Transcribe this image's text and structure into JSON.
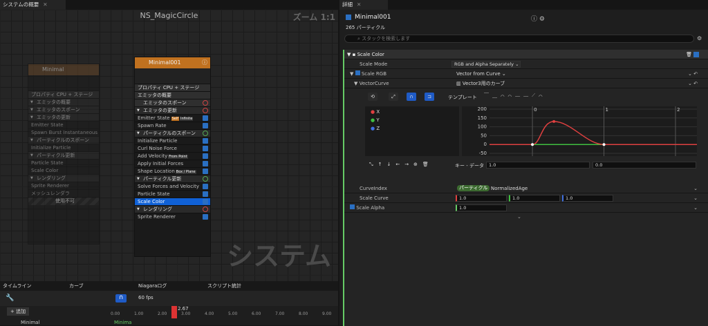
{
  "tabs": {
    "overview": "システムの概要",
    "detail": "詳細"
  },
  "graph": {
    "title": "NS_MagicCircle",
    "zoom": "ズーム 1:1",
    "watermark": "システム"
  },
  "node_left": {
    "title": "Minimal",
    "prop": "プロパティ",
    "cpu": "CPU",
    "stage": "ステージ",
    "rows": [
      "エミッタの概要",
      "エミッタのスポーン",
      "エミッタの更新",
      "Emitter State",
      "Spawn Burst Instantaneous",
      "パーティクルのスポーン",
      "Initialize Particle",
      "パーティクル更新",
      "Particle State",
      "Scale Color",
      "レンダリング",
      "Sprite Renderer",
      "メッシュレンダラ"
    ],
    "self": "Self",
    "infinite": "Infinite",
    "disabled": "使用不可"
  },
  "node_main": {
    "title": "Minimal001",
    "prop": "プロパティ",
    "cpu": "CPU",
    "stage": "ステージ",
    "overview": "エミッタの概要",
    "spawn": "エミッタのスポーン",
    "update": "エミッタの更新",
    "emitter_state": "Emitter State",
    "self": "Self",
    "infinite": "Infinite",
    "spawn_rate": "Spawn Rate",
    "pspawn": "パーティクルのスポーン",
    "init": "Initialize Particle",
    "curl": "Curl Noise Force",
    "addvel": "Add Velocity",
    "frompoint": "From Point",
    "forces": "Apply Initial Forces",
    "shape": "Shape Location",
    "boxplane": "Box / Plane",
    "pupdate": "パーティクル更新",
    "solve": "Solve Forces and Velocity",
    "pstate": "Particle State",
    "scale": "Scale Color",
    "render": "レンダリング",
    "sprite": "Sprite Renderer"
  },
  "bottom": {
    "tabs": [
      "タイムライン",
      "カーブ",
      "Niagaraログ",
      "スクリプト統計"
    ],
    "fps": "60 fps",
    "add": "追加",
    "track": "Minimal",
    "track2": "Minima",
    "playhead": "2.67",
    "ticks": [
      "0.00",
      "1.00",
      "2.00",
      "3.00",
      "4.00",
      "5.00",
      "6.00",
      "7.00",
      "8.00",
      "9.00"
    ]
  },
  "detail": {
    "name": "Minimal001",
    "count": "265 パーティクル",
    "search": "スタックを検索します",
    "section": "Scale Color",
    "scale_mode": "Scale Mode",
    "scale_mode_val": "RGB and Alpha Separately",
    "scale_rgb": "Scale RGB",
    "vfc": "Vector from Curve",
    "vcurve": "VectorCurve",
    "vcurve_val": "Vector3用のカーブ",
    "template": "テンプレート",
    "channels": [
      "X",
      "Y",
      "Z"
    ],
    "keydata": "キー - データ",
    "key1": "1.0",
    "key2": "0.0",
    "curve_index": "CurveIndex",
    "pill": "パーティクル",
    "norm_age": "NormalizedAge",
    "scale_curve": "Scale Curve",
    "sc": [
      "1.0",
      "1.0",
      "1.0"
    ],
    "scale_alpha": "Scale Alpha",
    "alpha": "1.0",
    "y_ticks": [
      "200",
      "150",
      "100",
      "50",
      "0",
      "-50"
    ],
    "x_ticks": [
      "0",
      "1",
      "2"
    ]
  },
  "chart_data": {
    "type": "line",
    "x": [
      0,
      0.3,
      1
    ],
    "series": [
      {
        "name": "X",
        "values": [
          0,
          130,
          0
        ]
      },
      {
        "name": "Y",
        "values": [
          0,
          0,
          0
        ]
      },
      {
        "name": "Z",
        "values": [
          0,
          0,
          0
        ]
      }
    ],
    "xlim": [
      -0.6,
      2.3
    ],
    "ylim": [
      -50,
      200
    ]
  },
  "colors": {
    "accent": "#1061d6",
    "emitter": "#c0711f",
    "x": "#e04040",
    "y": "#40c040",
    "z": "#4070e0"
  }
}
